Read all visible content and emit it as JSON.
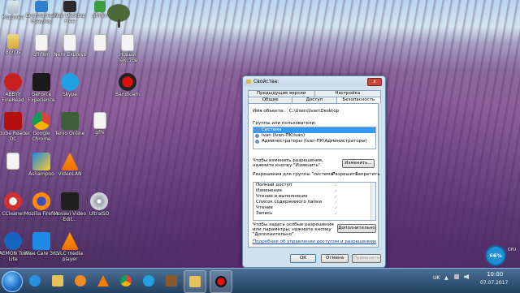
{
  "desktop": {
    "icons": [
      {
        "label": "Корзина",
        "icon": "recycle-bin-icon"
      },
      {
        "label": "Бесплатный браузер",
        "icon": "browser-icon"
      },
      {
        "label": "Neo Desktop Free",
        "icon": "app-icon"
      },
      {
        "label": "gfhfkn",
        "icon": "app-icon"
      },
      {
        "label": "Bonus",
        "icon": "folder-icon"
      },
      {
        "label": "gfhfkm",
        "icon": "document-icon"
      },
      {
        "label": "Nero Express",
        "icon": "app-icon"
      },
      {
        "label": "",
        "icon": "document-icon"
      },
      {
        "label": "Новый текстов",
        "icon": "document-icon"
      },
      {
        "label": "ABBYY FineRead",
        "icon": "abbyy-icon"
      },
      {
        "label": "GeForce Experience",
        "icon": "geforce-icon"
      },
      {
        "label": "Skype",
        "icon": "skype-icon"
      },
      {
        "label": "Bandicam",
        "icon": "bandicam-icon"
      },
      {
        "label": "Adobe Reader DC",
        "icon": "adobe-reader-icon"
      },
      {
        "label": "Google Chrome",
        "icon": "chrome-icon"
      },
      {
        "label": "Tenio Online",
        "icon": "tenio-icon"
      },
      {
        "label": "gfhi",
        "icon": "document-icon"
      },
      {
        "label": "",
        "icon": "document-icon"
      },
      {
        "label": "Ashampoo",
        "icon": "ashampoo-icon"
      },
      {
        "label": "VideoLAN",
        "icon": "vlc-icon"
      },
      {
        "label": "CCleaner",
        "icon": "ccleaner-icon"
      },
      {
        "label": "Mozilla Firefox",
        "icon": "firefox-icon"
      },
      {
        "label": "Movavi Video Edit...",
        "icon": "movavi-icon"
      },
      {
        "label": "UltraISO",
        "icon": "ultraiso-icon"
      },
      {
        "label": "DAEMON Tools Lite",
        "icon": "daemon-tools-icon"
      },
      {
        "label": "Wise Care 365",
        "icon": "wise-care-icon"
      },
      {
        "label": "VLC media player",
        "icon": "vlc-icon"
      }
    ]
  },
  "dialog": {
    "title": "Свойства:",
    "close_label": "x",
    "tabs_row1": [
      "Предыдущие версии",
      "Настройка"
    ],
    "tabs_row2": [
      "Общие",
      "Доступ",
      "Безопасность"
    ],
    "object_name_label": "Имя объекта:",
    "object_name_value": "C:\\Users\\Ivan\\Desktop",
    "groups_label": "Группы или пользователи:",
    "groups": [
      {
        "name": "Система",
        "selected": true
      },
      {
        "name": "Ivan (Ivan-ПК\\Ivan)",
        "selected": false
      },
      {
        "name": "Администраторы (Ivan-ПК\\Администраторы)",
        "selected": false
      }
    ],
    "change_hint": "Чтобы изменить разрешения, нажмите кнопку \"Изменить\".",
    "change_button": "Изменить...",
    "perms_label": "Разрешения для группы \"система\"",
    "allow_label": "Разрешить",
    "deny_label": "Запретить",
    "permissions": [
      "Полный доступ",
      "Изменение",
      "Чтение и выполнение",
      "Список содержимого папки",
      "Чтение",
      "Запись"
    ],
    "special_hint": "Чтобы задать особые разрешения или параметры, нажмите кнопку \"Дополнительно\".",
    "advanced_button": "Дополнительно",
    "link_text": "Подробнее об управлении доступом и разрешениях",
    "ok_button": "ОК",
    "cancel_button": "Отмена",
    "apply_button": "Применить"
  },
  "taskbar": {
    "apps": [
      "ie-icon",
      "explorer-icon",
      "media-player-icon",
      "vlc-icon",
      "chrome-icon",
      "skype-icon",
      "game-icon",
      "bandicam-icon"
    ],
    "lang": "UK",
    "time": "10:00",
    "date": "07.07.2017"
  },
  "gadget": {
    "value": "66%",
    "label": "CPU"
  }
}
